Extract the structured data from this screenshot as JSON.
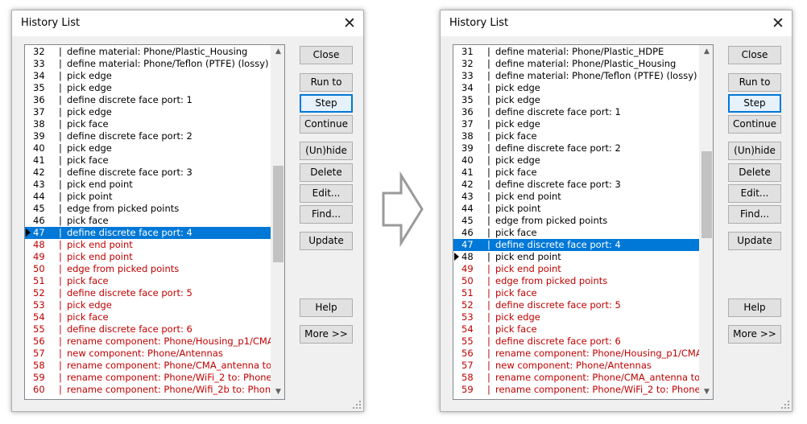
{
  "left_dialog": {
    "title": "History List",
    "rows": [
      {
        "num": "32",
        "text": "define material: Phone/Plastic_Housing",
        "state": "done"
      },
      {
        "num": "33",
        "text": "define material: Phone/Teflon (PTFE) (lossy)",
        "state": "done"
      },
      {
        "num": "34",
        "text": "pick edge",
        "state": "done"
      },
      {
        "num": "35",
        "text": "pick edge",
        "state": "done"
      },
      {
        "num": "36",
        "text": "define discrete face port: 1",
        "state": "done"
      },
      {
        "num": "37",
        "text": "pick edge",
        "state": "done"
      },
      {
        "num": "38",
        "text": "pick face",
        "state": "done"
      },
      {
        "num": "39",
        "text": "define discrete face port: 2",
        "state": "done"
      },
      {
        "num": "40",
        "text": "pick edge",
        "state": "done"
      },
      {
        "num": "41",
        "text": "pick face",
        "state": "done"
      },
      {
        "num": "42",
        "text": "define discrete face port: 3",
        "state": "done"
      },
      {
        "num": "43",
        "text": "pick end point",
        "state": "done"
      },
      {
        "num": "44",
        "text": "pick point",
        "state": "done"
      },
      {
        "num": "45",
        "text": "edge from picked points",
        "state": "done"
      },
      {
        "num": "46",
        "text": "pick face",
        "state": "done"
      },
      {
        "num": "47",
        "text": "define discrete face port: 4",
        "state": "selected",
        "marker": true
      },
      {
        "num": "48",
        "text": "pick end point",
        "state": "future"
      },
      {
        "num": "49",
        "text": "pick end point",
        "state": "future"
      },
      {
        "num": "50",
        "text": "edge from picked points",
        "state": "future"
      },
      {
        "num": "51",
        "text": "pick face",
        "state": "future"
      },
      {
        "num": "52",
        "text": "define discrete face port: 5",
        "state": "future"
      },
      {
        "num": "53",
        "text": "pick edge",
        "state": "future"
      },
      {
        "num": "54",
        "text": "pick face",
        "state": "future"
      },
      {
        "num": "55",
        "text": "define discrete face port: 6",
        "state": "future"
      },
      {
        "num": "56",
        "text": "rename component: Phone/Housing_p1/CMA_",
        "state": "future"
      },
      {
        "num": "57",
        "text": "new component: Phone/Antennas",
        "state": "future"
      },
      {
        "num": "58",
        "text": "rename component: Phone/CMA_antenna to:",
        "state": "future"
      },
      {
        "num": "59",
        "text": "rename component: Phone/WiFi_2 to: Phone/",
        "state": "future"
      },
      {
        "num": "60",
        "text": "rename component: Phone/Wifi_2b to: Phone",
        "state": "future"
      }
    ]
  },
  "right_dialog": {
    "title": "History List",
    "rows": [
      {
        "num": "31",
        "text": "define material: Phone/Plastic_HDPE",
        "state": "done"
      },
      {
        "num": "32",
        "text": "define material: Phone/Plastic_Housing",
        "state": "done"
      },
      {
        "num": "33",
        "text": "define material: Phone/Teflon (PTFE) (lossy)",
        "state": "done"
      },
      {
        "num": "34",
        "text": "pick edge",
        "state": "done"
      },
      {
        "num": "35",
        "text": "pick edge",
        "state": "done"
      },
      {
        "num": "36",
        "text": "define discrete face port: 1",
        "state": "done"
      },
      {
        "num": "37",
        "text": "pick edge",
        "state": "done"
      },
      {
        "num": "38",
        "text": "pick face",
        "state": "done"
      },
      {
        "num": "39",
        "text": "define discrete face port: 2",
        "state": "done"
      },
      {
        "num": "40",
        "text": "pick edge",
        "state": "done"
      },
      {
        "num": "41",
        "text": "pick face",
        "state": "done"
      },
      {
        "num": "42",
        "text": "define discrete face port: 3",
        "state": "done"
      },
      {
        "num": "43",
        "text": "pick end point",
        "state": "done"
      },
      {
        "num": "44",
        "text": "pick point",
        "state": "done"
      },
      {
        "num": "45",
        "text": "edge from picked points",
        "state": "done"
      },
      {
        "num": "46",
        "text": "pick face",
        "state": "done"
      },
      {
        "num": "47",
        "text": "define discrete face port: 4",
        "state": "selected"
      },
      {
        "num": "48",
        "text": "pick end point",
        "state": "done",
        "marker": true
      },
      {
        "num": "49",
        "text": "pick end point",
        "state": "future"
      },
      {
        "num": "50",
        "text": "edge from picked points",
        "state": "future"
      },
      {
        "num": "51",
        "text": "pick face",
        "state": "future"
      },
      {
        "num": "52",
        "text": "define discrete face port: 5",
        "state": "future"
      },
      {
        "num": "53",
        "text": "pick edge",
        "state": "future"
      },
      {
        "num": "54",
        "text": "pick face",
        "state": "future"
      },
      {
        "num": "55",
        "text": "define discrete face port: 6",
        "state": "future"
      },
      {
        "num": "56",
        "text": "rename component: Phone/Housing_p1/CMA_",
        "state": "future"
      },
      {
        "num": "57",
        "text": "new component: Phone/Antennas",
        "state": "future"
      },
      {
        "num": "58",
        "text": "rename component: Phone/CMA_antenna to:",
        "state": "future"
      },
      {
        "num": "59",
        "text": "rename component: Phone/WiFi_2 to: Phone",
        "state": "future"
      }
    ]
  },
  "buttons": {
    "close": "Close",
    "run_to": "Run to",
    "step": "Step",
    "continue": "Continue",
    "unhide": "(Un)hide",
    "delete": "Delete",
    "edit": "Edit...",
    "find": "Find...",
    "update": "Update",
    "help": "Help",
    "more": "More >>"
  },
  "colors": {
    "selection": "#0078d7",
    "future_text": "#c00000",
    "default_button_border": "#0078d7"
  },
  "icons": {
    "current_step_marker": "triangle-right-icon",
    "transition_arrow": "hollow-right-arrow-icon"
  }
}
